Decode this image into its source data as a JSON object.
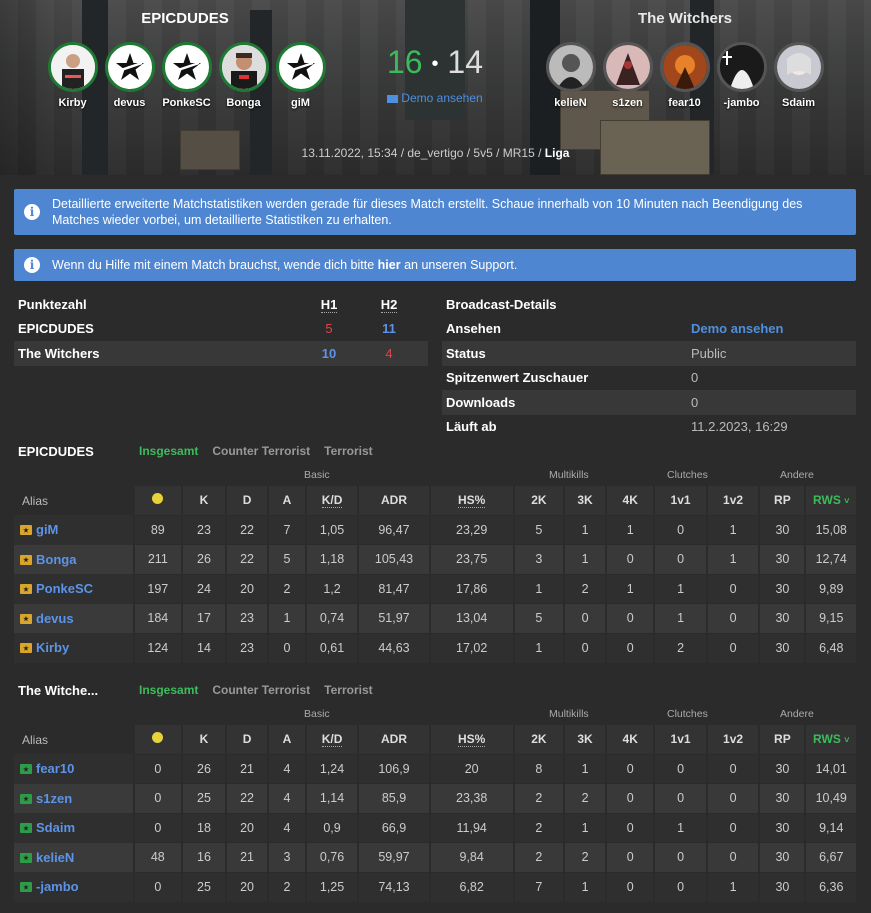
{
  "header": {
    "team1": {
      "name": "EPICDUDES",
      "players": [
        "Kirby",
        "devus",
        "PonkeSC",
        "Bonga",
        "giM"
      ]
    },
    "team2": {
      "name": "The Witchers",
      "players": [
        "kelieN",
        "s1zen",
        "fear10",
        "-jambo",
        "Sdaim"
      ]
    },
    "score1": "16",
    "score2": "14",
    "demo_link": "Demo ansehen",
    "match_info_prefix": "13.11.2022, 15:34 / de_vertigo / 5v5 / MR15 /",
    "match_info_type": "Liga"
  },
  "alerts": {
    "stats_notice": "Detaillierte erweiterte Matchstatistiken werden gerade für dieses Match erstellt. Schaue innerhalb von 10 Minuten nach Beendigung des Matches wieder vorbei, um detaillierte Statistiken zu erhalten.",
    "help_prefix": "Wenn du Hilfe mit einem Match brauchst, wende dich bitte",
    "help_link": "hier",
    "help_suffix": "an unseren Support."
  },
  "score_table": {
    "title": "Punktezahl",
    "h1": "H1",
    "h2": "H2",
    "rows": [
      {
        "team": "EPICDUDES",
        "h1": "5",
        "h2": "11"
      },
      {
        "team": "The Witchers",
        "h1": "10",
        "h2": "4"
      }
    ]
  },
  "broadcast": {
    "title": "Broadcast-Details",
    "rows": [
      {
        "label": "Ansehen",
        "value": "Demo ansehen"
      },
      {
        "label": "Status",
        "value": "Public"
      },
      {
        "label": "Spitzenwert Zuschauer",
        "value": "0"
      },
      {
        "label": "Downloads",
        "value": "0"
      },
      {
        "label": "Läuft ab",
        "value": "11.2.2023, 16:29"
      }
    ]
  },
  "stats": {
    "tabs": [
      "Insgesamt",
      "Counter Terrorist",
      "Terrorist"
    ],
    "groups": [
      "Basic",
      "Multikills",
      "Clutches",
      "Andere"
    ],
    "columns": [
      "Alias",
      "K",
      "D",
      "A",
      "K/D",
      "ADR",
      "HS%",
      "2K",
      "3K",
      "4K",
      "1v1",
      "1v2",
      "RP",
      "RWS"
    ],
    "team1": {
      "name": "EPICDUDES",
      "rows": [
        [
          "giM",
          "89",
          "23",
          "22",
          "7",
          "1,05",
          "96,47",
          "23,29",
          "5",
          "1",
          "1",
          "0",
          "1",
          "30",
          "15,08"
        ],
        [
          "Bonga",
          "211",
          "26",
          "22",
          "5",
          "1,18",
          "105,43",
          "23,75",
          "3",
          "1",
          "0",
          "0",
          "1",
          "30",
          "12,74"
        ],
        [
          "PonkeSC",
          "197",
          "24",
          "20",
          "2",
          "1,2",
          "81,47",
          "17,86",
          "1",
          "2",
          "1",
          "1",
          "0",
          "30",
          "9,89"
        ],
        [
          "devus",
          "184",
          "17",
          "23",
          "1",
          "0,74",
          "51,97",
          "13,04",
          "5",
          "0",
          "0",
          "1",
          "0",
          "30",
          "9,15"
        ],
        [
          "Kirby",
          "124",
          "14",
          "23",
          "0",
          "0,61",
          "44,63",
          "17,02",
          "1",
          "0",
          "0",
          "2",
          "0",
          "30",
          "6,48"
        ]
      ]
    },
    "team2": {
      "name": "The Witche...",
      "rows": [
        [
          "fear10",
          "0",
          "26",
          "21",
          "4",
          "1,24",
          "106,9",
          "20",
          "8",
          "1",
          "0",
          "0",
          "0",
          "30",
          "14,01"
        ],
        [
          "s1zen",
          "0",
          "25",
          "22",
          "4",
          "1,14",
          "85,9",
          "23,38",
          "2",
          "2",
          "0",
          "0",
          "0",
          "30",
          "10,49"
        ],
        [
          "Sdaim",
          "0",
          "18",
          "20",
          "4",
          "0,9",
          "66,9",
          "11,94",
          "2",
          "1",
          "0",
          "1",
          "0",
          "30",
          "9,14"
        ],
        [
          "kelieN",
          "48",
          "16",
          "21",
          "3",
          "0,76",
          "59,97",
          "9,84",
          "2",
          "2",
          "0",
          "0",
          "0",
          "30",
          "6,67"
        ],
        [
          "-jambo",
          "0",
          "25",
          "20",
          "2",
          "1,25",
          "74,13",
          "6,82",
          "7",
          "1",
          "0",
          "0",
          "1",
          "30",
          "6,36"
        ]
      ]
    }
  }
}
